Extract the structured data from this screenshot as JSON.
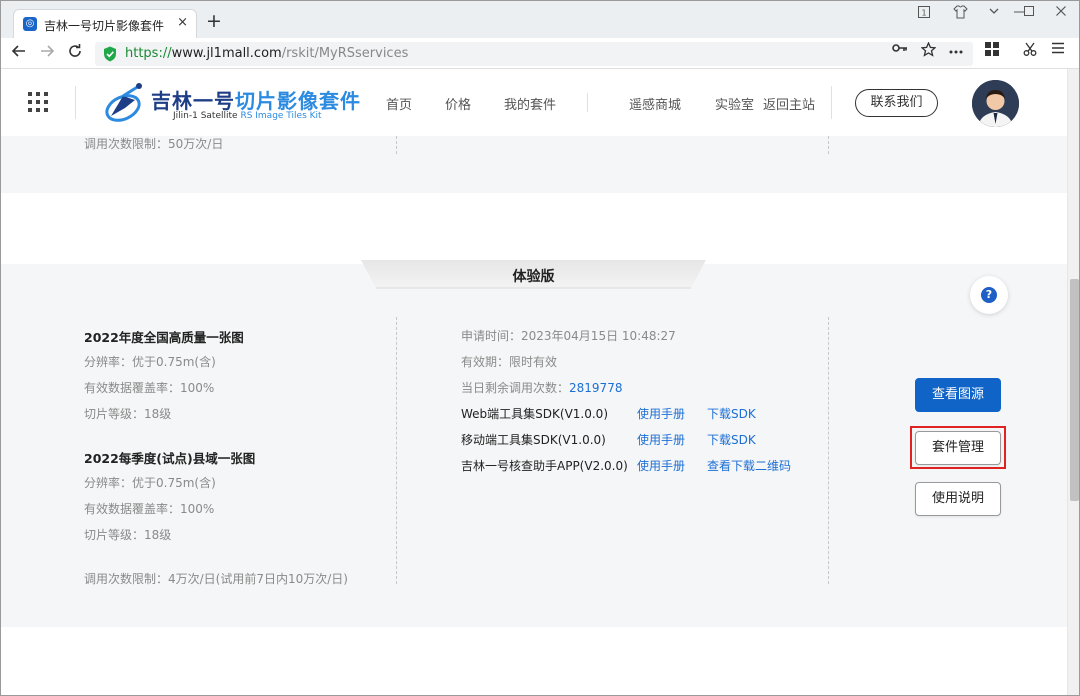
{
  "browser": {
    "tab_title": "吉林一号切片影像套件",
    "tab_close": "×",
    "new_tab": "+",
    "url_scheme": "https://",
    "url_host": "www.jl1mall.com",
    "url_path": "/rskit/MyRSservices",
    "window_controls": {
      "count_badge": "1"
    }
  },
  "site": {
    "logo_brand": "吉林一号",
    "logo_accent": "切片影像套件",
    "logo_sub_a": "Jilin-1  Satellite",
    "logo_sub_b": "RS Image Tiles Kit",
    "nav": [
      "首页",
      "价格",
      "我的套件",
      "遥感商城",
      "实验室",
      "返回主站"
    ],
    "contact": "联系我们"
  },
  "prev_section": {
    "call_limit": "调用次数限制：50万次/日"
  },
  "plan": {
    "tab_label": "体验版",
    "products": [
      {
        "name": "2022年度全国高质量一张图",
        "resolution": "分辨率：优于0.75m(含)",
        "coverage": "有效数据覆盖率：100%",
        "tile_level": "切片等级：18级"
      },
      {
        "name": "2022每季度(试点)县域一张图",
        "resolution": "分辨率：优于0.75m(含)",
        "coverage": "有效数据覆盖率：100%",
        "tile_level": "切片等级：18级"
      }
    ],
    "call_limit": "调用次数限制：4万次/日(试用前7日内10万次/日)",
    "apply_time": "申请时间：2023年04月15日 10:48:27",
    "validity": "有效期：限时有效",
    "remaining_label": "当日剩余调用次数：",
    "remaining_value": "2819778",
    "sdks": [
      {
        "name": "Web端工具集SDK(V1.0.0)",
        "manual": "使用手册",
        "download": "下载SDK"
      },
      {
        "name": "移动端工具集SDK(V1.0.0)",
        "manual": "使用手册",
        "download": "下载SDK"
      },
      {
        "name": "吉林一号核查助手APP(V2.0.0)",
        "manual": "使用手册",
        "download": "查看下载二维码"
      }
    ],
    "buttons": {
      "view_source": "查看图源",
      "manage": "套件管理",
      "instructions": "使用说明"
    },
    "help": "?"
  },
  "colors": {
    "primary": "#1064c7",
    "link": "#1c6fd6",
    "highlight": "#e02222"
  }
}
